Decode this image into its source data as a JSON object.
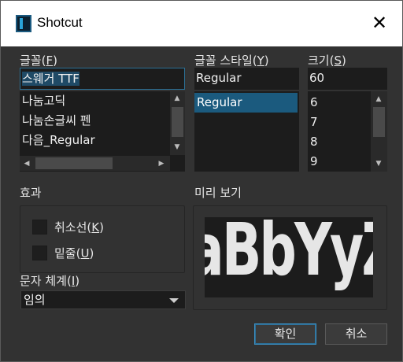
{
  "window": {
    "title": "Shotcut",
    "close_glyph": "✕",
    "app_icon": "shotcut-icon"
  },
  "font": {
    "label_text": "글꼴(",
    "label_mnemonic": "F",
    "label_close": ")",
    "value": "스웨거 TTF",
    "items": [
      "나눔고딕",
      "나눔손글씨 펜",
      "다음_Regular"
    ]
  },
  "style": {
    "label_text": "글꼴 스타일(",
    "label_mnemonic": "Y",
    "label_close": ")",
    "value": "Regular",
    "items": [
      "Regular"
    ],
    "selected": "Regular"
  },
  "size": {
    "label_text": "크기(",
    "label_mnemonic": "S",
    "label_close": ")",
    "value": "60",
    "items": [
      "6",
      "7",
      "8",
      "9"
    ]
  },
  "effects": {
    "label": "효과",
    "strikeout_text": "취소선(",
    "strikeout_mnemonic": "K",
    "strikeout_close": ")",
    "strikeout_checked": false,
    "underline_text": "밑줄(",
    "underline_mnemonic": "U",
    "underline_close": ")",
    "underline_checked": false
  },
  "preview": {
    "label": "미리 보기",
    "sample": "aBbYyZz"
  },
  "script": {
    "label_text": "문자 체계(",
    "label_mnemonic": "I",
    "label_close": ")",
    "value": "임의"
  },
  "buttons": {
    "ok": "확인",
    "cancel": "취소"
  },
  "colors": {
    "background": "#323232",
    "selection": "#1b5a7e",
    "default_button_border": "#3b8fc3"
  }
}
